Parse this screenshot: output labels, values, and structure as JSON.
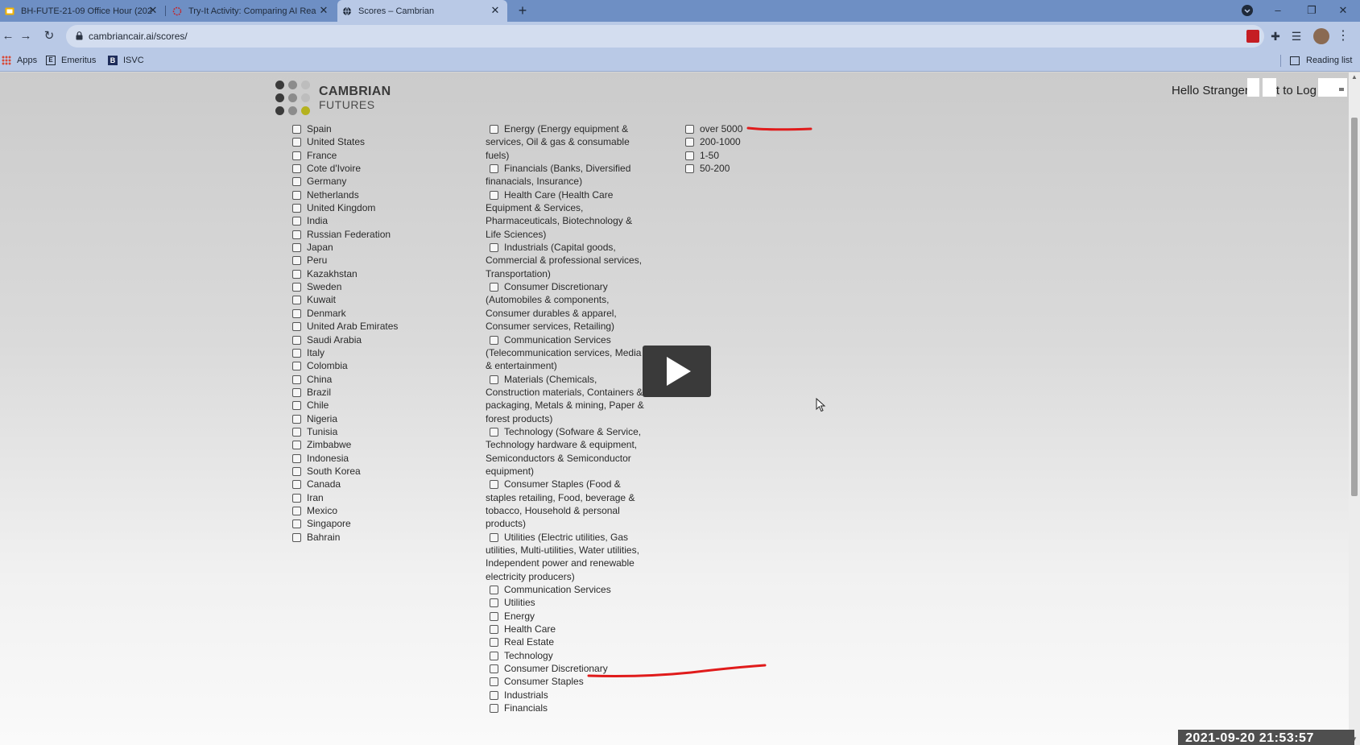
{
  "browser": {
    "tabs": [
      {
        "title": "BH-FUTE-21-09 Office Hour (202",
        "active": false,
        "icon": "slides-icon"
      },
      {
        "title": "Try-It Activity: Comparing AI Rea",
        "active": false,
        "icon": "emeritus-loading-icon"
      },
      {
        "title": "Scores – Cambrian",
        "active": true,
        "icon": "globe-icon"
      }
    ],
    "new_tab": "+",
    "window_controls": {
      "minimize": "–",
      "restore": "❐",
      "close": "✕"
    },
    "url": "cambriancair.ai/scores/",
    "bookmarks": [
      {
        "label": "Apps",
        "icon": "apps-grid-icon"
      },
      {
        "label": "Emeritus",
        "icon": "emeritus-icon",
        "glyph": "E"
      },
      {
        "label": "ISVC",
        "icon": "isvc-icon",
        "glyph": "B"
      }
    ],
    "reading_list": "Reading list"
  },
  "page": {
    "logo": {
      "name": "CAMBRIAN",
      "sub": "FUTURES"
    },
    "logo_colors": {
      "dark": "#3b3b3b",
      "mid": "#8c8c8c",
      "light": "#bdbdbd",
      "accent": "#b5b21f"
    },
    "greeting": "Hello Stranger",
    "greeting_suffix": "t to Log",
    "countries": [
      "Spain",
      "United States",
      "France",
      "Cote d'Ivoire",
      "Germany",
      "Netherlands",
      "United Kingdom",
      "India",
      "Russian Federation",
      "Japan",
      "Peru",
      "Kazakhstan",
      "Sweden",
      "Kuwait",
      "Denmark",
      "United Arab Emirates",
      "Saudi Arabia",
      "Italy",
      "Colombia",
      "China",
      "Brazil",
      "Chile",
      "Nigeria",
      "Tunisia",
      "Zimbabwe",
      "Indonesia",
      "South Korea",
      "Canada",
      "Iran",
      "Mexico",
      "Singapore",
      "Bahrain"
    ],
    "sectors": [
      "Energy (Energy equipment & services, Oil & gas & consumable fuels)",
      "Financials (Banks, Diversified finanacials, Insurance)",
      "Health Care (Health Care Equipment & Services, Pharmaceuticals, Biotechnology & Life Sciences)",
      "Industrials (Capital goods, Commercial & professional services, Transportation)",
      "Consumer Discretionary (Automobiles & components, Consumer durables & apparel, Consumer services, Retailing)",
      "Communication Services (Telecommunication services, Media & entertainment)",
      "Materials (Chemicals, Construction materials, Containers & packaging, Metals & mining, Paper & forest products)",
      "Technology (Sofware & Service, Technology hardware & equipment, Semiconductors & Semiconductor equipment)",
      "Consumer Staples (Food & staples retailing, Food, beverage & tobacco, Household & personal products)",
      "Utilities (Electric utilities, Gas utilities, Multi-utilities, Water utilities, Independent power and renewable electricity producers)",
      "Communication Services",
      "Utilities",
      "Energy",
      "Health Care",
      "Real Estate",
      "Technology",
      "Consumer Discretionary",
      "Consumer Staples",
      "Industrials",
      "Financials"
    ],
    "company_sizes": [
      "over 5000",
      "200-1000",
      "1-50",
      "50-200"
    ],
    "annotation_color": "#e01b1b"
  },
  "overlay": {
    "timestamp": "2021-09-20  21:53:57"
  }
}
